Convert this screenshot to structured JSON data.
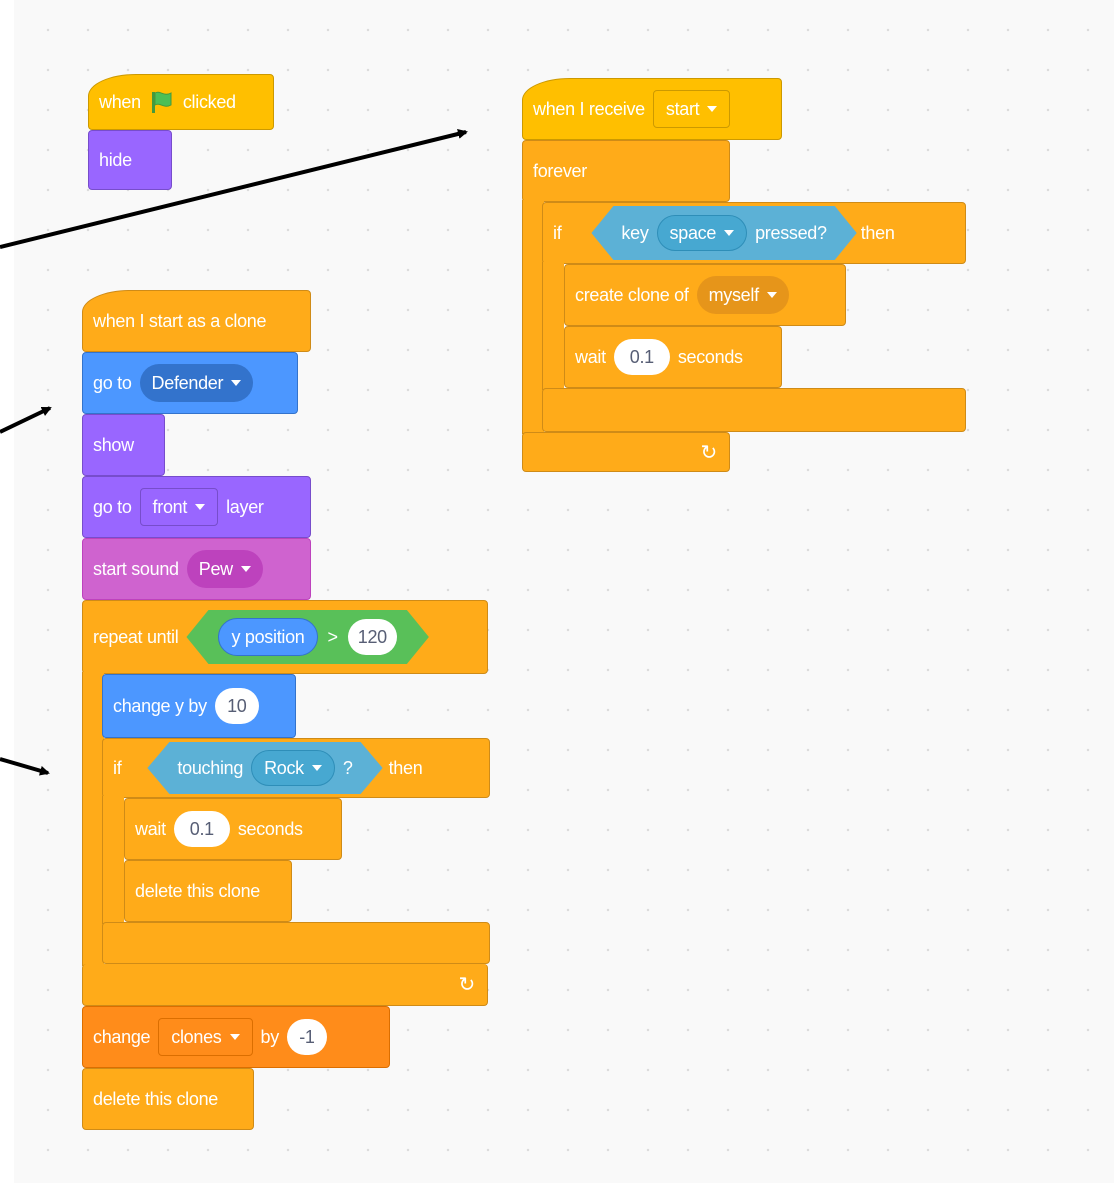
{
  "script1": {
    "hat_when": "when",
    "hat_clicked": "clicked",
    "hide": "hide"
  },
  "script2": {
    "hat": "when I start as a clone",
    "goto_label": "go to",
    "goto_target": "Defender",
    "show": "show",
    "layer_goto": "go to",
    "layer_target": "front",
    "layer_suffix": "layer",
    "sound_label": "start sound",
    "sound_name": "Pew",
    "repeat_label": "repeat until",
    "repeat_reporter": "y position",
    "repeat_op": ">",
    "repeat_value": "120",
    "changey_label": "change y by",
    "changey_value": "10",
    "if_label": "if",
    "touching_label": "touching",
    "touching_target": "Rock",
    "touching_q": "?",
    "then_label": "then",
    "wait_label": "wait",
    "wait_value": "0.1",
    "wait_suffix": "seconds",
    "delete_inner": "delete this clone",
    "change_label": "change",
    "change_var": "clones",
    "change_by": "by",
    "change_value": "-1",
    "delete_last": "delete this clone"
  },
  "script3": {
    "hat_label": "when I receive",
    "hat_message": "start",
    "forever": "forever",
    "if_label": "if",
    "key_label": "key",
    "key_name": "space",
    "pressed": "pressed?",
    "then_label": "then",
    "create_label": "create clone of",
    "create_target": "myself",
    "wait_label": "wait",
    "wait_value": "0.1",
    "wait_suffix": "seconds"
  },
  "colors": {
    "events": "#ffbf00",
    "looks": "#9966ff",
    "control": "#ffab19",
    "motion": "#4c97ff",
    "sound": "#cf63cf",
    "variables": "#ff8c1a",
    "operators": "#59c059",
    "sensing": "#5cb1d6"
  },
  "icons": [
    "green-flag-icon",
    "dropdown-arrow-icon",
    "loop-arrow-icon"
  ]
}
